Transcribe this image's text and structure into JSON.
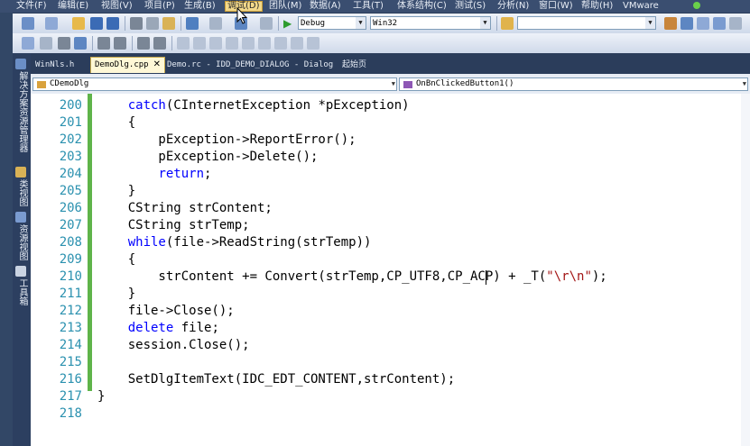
{
  "menu": {
    "items": [
      "文件(F)",
      "编辑(E)",
      "视图(V)",
      "项目(P)",
      "生成(B)",
      "调试(D)",
      "团队(M)",
      "数据(A)",
      "工具(T)",
      "体系结构(C)",
      "测试(S)",
      "分析(N)",
      "窗口(W)",
      "帮助(H)",
      "VMware"
    ]
  },
  "toolbar": {
    "config": "Debug",
    "platform": "Win32",
    "find": ""
  },
  "dock": {
    "items": [
      "解决方案资源管理器",
      "类视图",
      "资源视图",
      "工具箱"
    ]
  },
  "tabs": [
    {
      "label": "WinNls.h",
      "active": false
    },
    {
      "label": "DemoDlg.cpp",
      "active": true
    },
    {
      "label": "Demo.rc - IDD_DEMO_DIALOG - Dialog",
      "active": false
    },
    {
      "label": "起始页",
      "active": false
    }
  ],
  "navbar": {
    "class_combo": "CDemoDlg",
    "member_combo": "OnBnClickedButton1()"
  },
  "editor": {
    "lines": [
      {
        "n": "200",
        "t": "catch(CInternetException *pException)"
      },
      {
        "n": "201",
        "t": "{"
      },
      {
        "n": "202",
        "t": "    pException->ReportError();"
      },
      {
        "n": "203",
        "t": "    pException->Delete();"
      },
      {
        "n": "204",
        "t": "    return;"
      },
      {
        "n": "205",
        "t": "}"
      },
      {
        "n": "206",
        "t": "CString strContent;"
      },
      {
        "n": "207",
        "t": "CString strTemp;"
      },
      {
        "n": "208",
        "t": "while(file->ReadString(strTemp))"
      },
      {
        "n": "209",
        "t": "{"
      },
      {
        "n": "210",
        "t": "    strContent += Convert(strTemp,CP_UTF8,CP_ACP) + _T(\"\\r\\n\");"
      },
      {
        "n": "211",
        "t": "}"
      },
      {
        "n": "212",
        "t": "file->Close();"
      },
      {
        "n": "213",
        "t": "delete file;"
      },
      {
        "n": "214",
        "t": "session.Close();"
      },
      {
        "n": "215",
        "t": ""
      },
      {
        "n": "216",
        "t": "SetDlgItemText(IDC_EDT_CONTENT,strContent);"
      },
      {
        "n": "217",
        "t": "}"
      },
      {
        "n": "218",
        "t": ""
      }
    ]
  },
  "colors": {
    "keyword": "#0000ff",
    "string": "#a31515",
    "line_number": "#2b91af",
    "change_bar": "#5fb44a"
  }
}
